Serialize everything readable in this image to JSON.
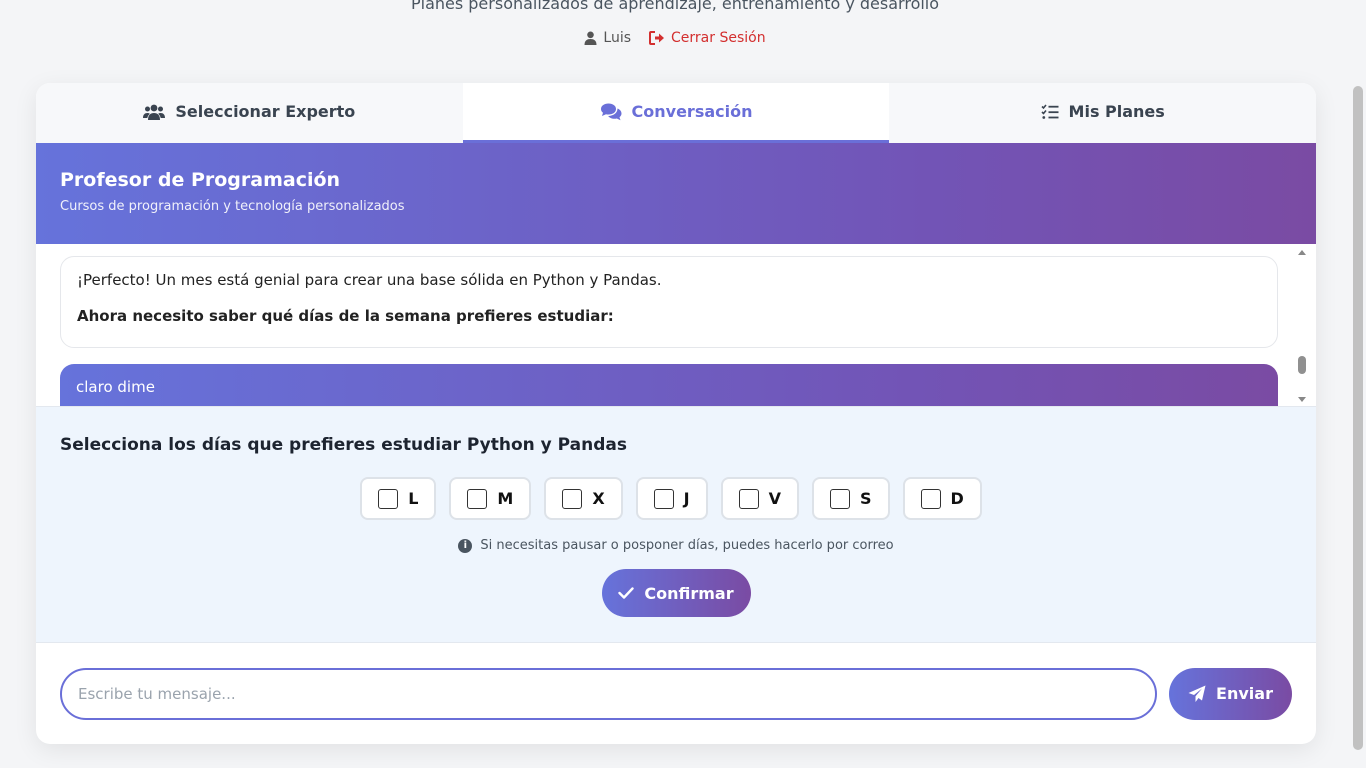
{
  "header": {
    "subtitle": "Planes personalizados de aprendizaje, entrenamiento y desarrollo",
    "user_name": "Luis",
    "logout_label": "Cerrar Sesión"
  },
  "tabs": [
    {
      "label": "Seleccionar Experto",
      "icon": "users-icon",
      "active": false
    },
    {
      "label": "Conversación",
      "icon": "chat-icon",
      "active": true
    },
    {
      "label": "Mis Planes",
      "icon": "checklist-icon",
      "active": false
    }
  ],
  "chat": {
    "expert_title": "Profesor de Programación",
    "expert_subtitle": "Cursos de programación y tecnología personalizados",
    "messages": {
      "bot_line1": "¡Perfecto! Un mes está genial para crear una base sólida en Python y Pandas.",
      "bot_line2": "Ahora necesito saber qué días de la semana prefieres estudiar:",
      "user_text": "claro dime"
    }
  },
  "days_panel": {
    "title": "Selecciona los días que prefieres estudiar Python y Pandas",
    "days": [
      "L",
      "M",
      "X",
      "J",
      "V",
      "S",
      "D"
    ],
    "hint": "Si necesitas pausar o posponer días, puedes hacerlo por correo",
    "confirm_label": "Confirmar"
  },
  "composer": {
    "placeholder": "Escribe tu mensaje...",
    "value": "",
    "send_label": "Enviar"
  },
  "colors": {
    "accent": "#6a6fd8",
    "gradient_start": "#6673db",
    "gradient_end": "#7a4ba3",
    "logout": "#d32f2f"
  }
}
